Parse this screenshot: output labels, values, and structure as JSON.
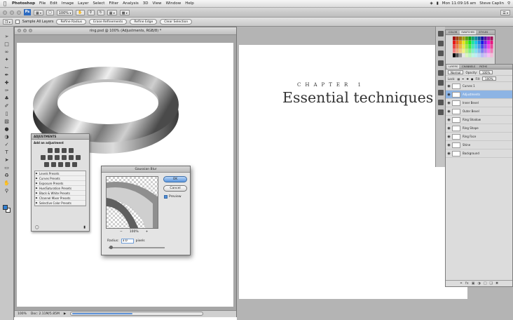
{
  "menubar": {
    "apple": "",
    "app_name": "Photoshop",
    "items": [
      "File",
      "Edit",
      "Image",
      "Layer",
      "Select",
      "Filter",
      "Analysis",
      "3D",
      "View",
      "Window",
      "Help"
    ],
    "clock": "Mon 11:09:16 am",
    "user": "Steve Caplin"
  },
  "appbar": {
    "logo": "Ps",
    "zoom": "100%"
  },
  "options": {
    "sample_label": "Sample All Layers",
    "buttons": [
      "Refine Radius",
      "Erase Refinements",
      "Refine Edge",
      "Clear Selection"
    ]
  },
  "document": {
    "title": "ring.psd @ 100% (Adjustments, RGB/8) *",
    "status_zoom": "100%",
    "status_info": "Doc: 2.11M/5.85M"
  },
  "adjustments_panel": {
    "tab": "ADJUSTMENTS",
    "title": "Add an adjustment",
    "presets": [
      "Levels Presets",
      "Curves Presets",
      "Exposure Presets",
      "Hue/Saturation Presets",
      "Black & White Presets",
      "Channel Mixer Presets",
      "Selective Color Presets"
    ]
  },
  "gaussian_blur": {
    "title": "Gaussian Blur",
    "ok": "OK",
    "cancel": "Cancel",
    "preview": "Preview",
    "zoom_out": "−",
    "zoom_value": "100%",
    "zoom_in": "+",
    "radius_label": "Radius:",
    "radius_value": "3.0",
    "radius_unit": "pixels"
  },
  "book": {
    "chapter_label": "CHAPTER 1",
    "chapter_title": "Essential techniques"
  },
  "color_panel": {
    "tabs": [
      "COLOR",
      "SWATCHES",
      "STYLES"
    ]
  },
  "layers_panel": {
    "tabs": [
      "LAYERS",
      "CHANNELS",
      "PATHS"
    ],
    "blend_mode": "Normal",
    "opacity_label": "Opacity:",
    "opacity_value": "100%",
    "lock_label": "Lock:",
    "fill_label": "Fill:",
    "fill_value": "100%",
    "layers": [
      {
        "name": "Curves 1"
      },
      {
        "name": "Adjustments",
        "active": true
      },
      {
        "name": "Inner Bevel"
      },
      {
        "name": "Outer Bevel"
      },
      {
        "name": "Ring Shadow"
      },
      {
        "name": "Ring Shape"
      },
      {
        "name": "Ring Face"
      },
      {
        "name": "Shine"
      },
      {
        "name": "Background"
      }
    ]
  },
  "colors": {
    "accent": "#5b97de",
    "foreground_swatch": "#2f7fd3"
  }
}
